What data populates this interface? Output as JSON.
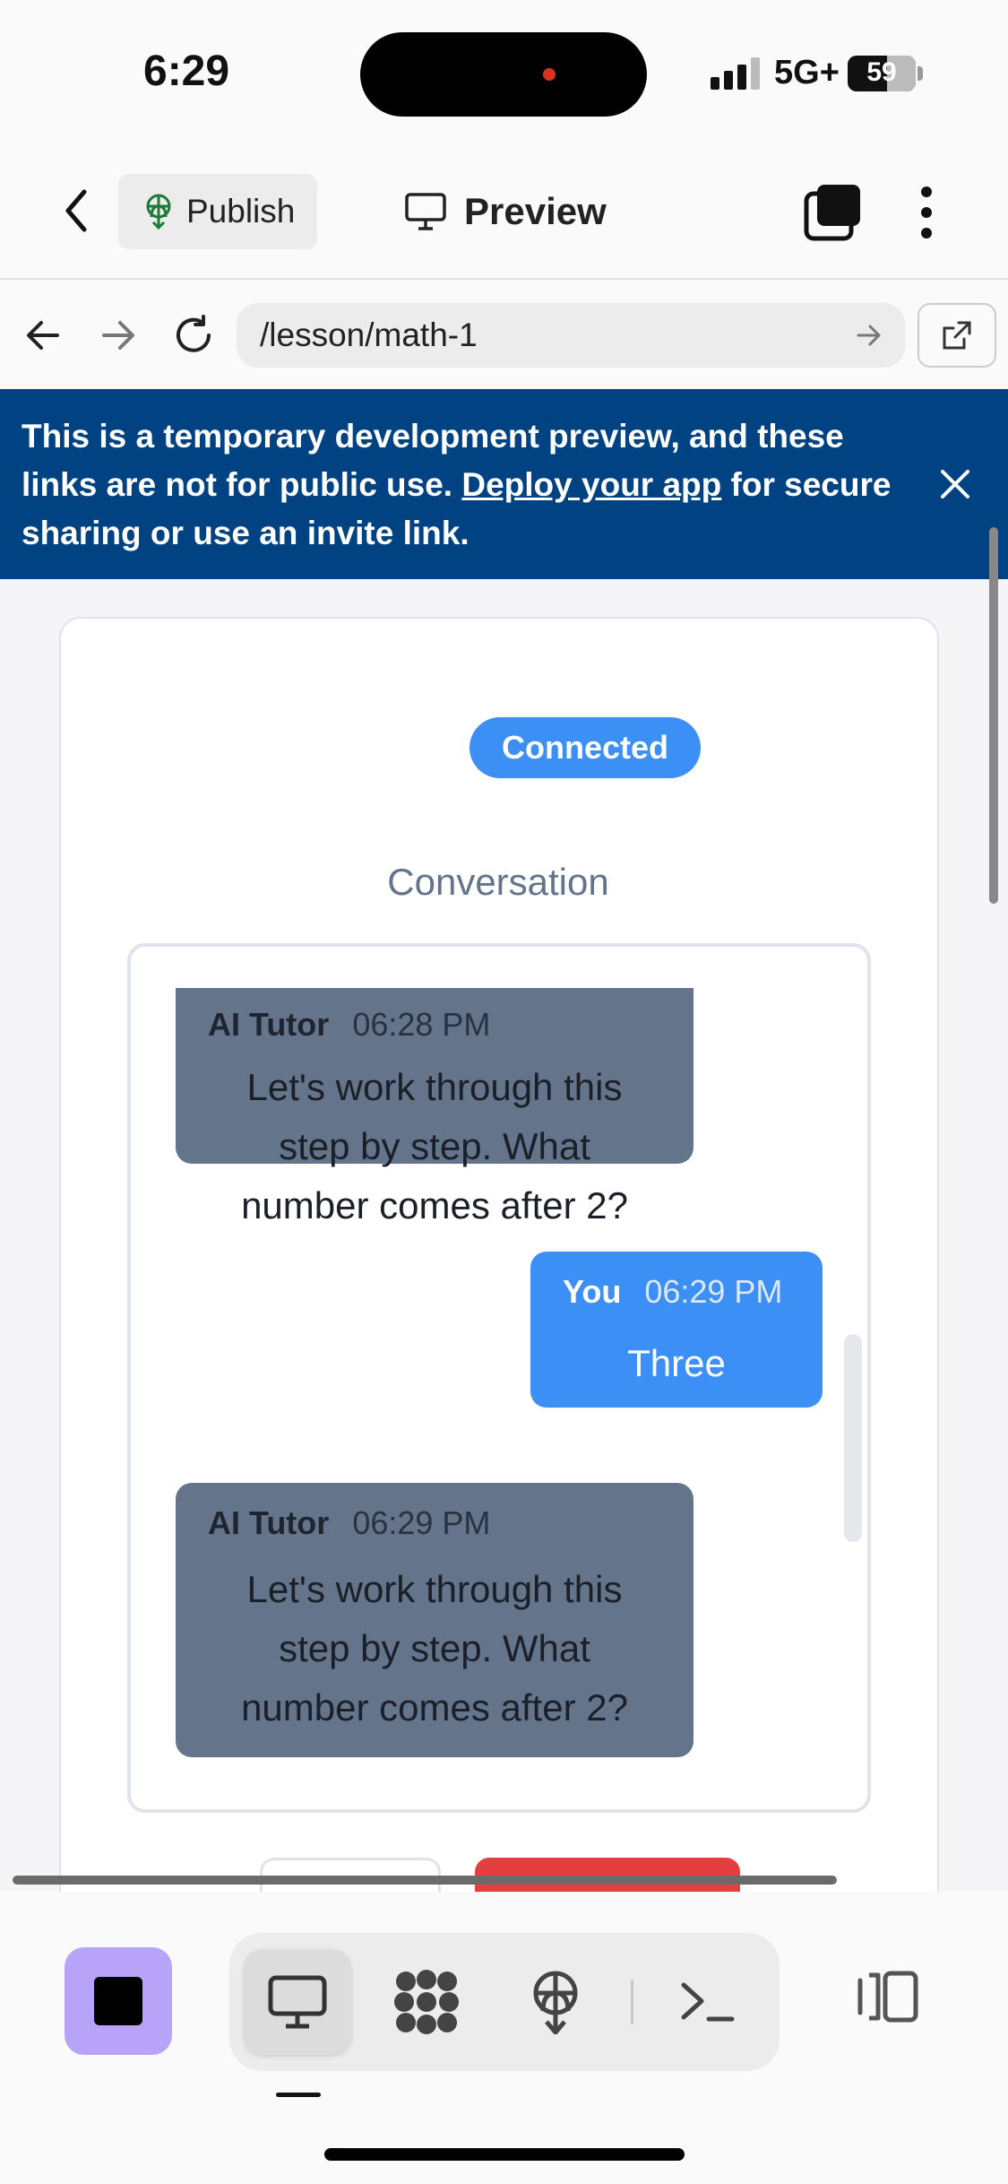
{
  "status_bar": {
    "time": "6:29",
    "network": "5G+",
    "battery": "59"
  },
  "toolbar": {
    "publish_label": "Publish",
    "preview_label": "Preview"
  },
  "url_bar": {
    "url": "/lesson/math-1"
  },
  "banner": {
    "text_before": "This is a temporary development preview, and these links are not for public use. ",
    "link_text": "Deploy your app",
    "text_after": " for secure sharing or use an invite link."
  },
  "app": {
    "status_badge": "Connected",
    "conversation_title": "Conversation",
    "messages": [
      {
        "sender": "AI Tutor",
        "time": "06:28 PM",
        "text": "Let's work through this step by step. What number comes after 2?"
      },
      {
        "sender": "You",
        "time": "06:29 PM",
        "text": "Three"
      },
      {
        "sender": "AI Tutor",
        "time": "06:29 PM",
        "text": "Let's work through this step by step. What number comes after 2?"
      }
    ]
  },
  "colors": {
    "banner_bg": "#004282",
    "accent_blue": "#3b8ff5",
    "ai_bubble": "#64748b",
    "stop_button": "#b7a3f8",
    "danger_red": "#e53e3e"
  },
  "icons": {
    "toolbar": [
      "back-chevron-icon",
      "publish-icon",
      "monitor-icon",
      "tabs-icon",
      "more-vertical-icon"
    ],
    "url_bar": [
      "arrow-left-icon",
      "arrow-right-icon",
      "reload-icon",
      "go-arrow-icon",
      "external-link-icon"
    ],
    "banner": [
      "close-icon"
    ],
    "dock": [
      "stop-icon",
      "monitor-icon",
      "workspace-icon",
      "publish-icon",
      "terminal-icon",
      "side-panel-icon"
    ]
  }
}
